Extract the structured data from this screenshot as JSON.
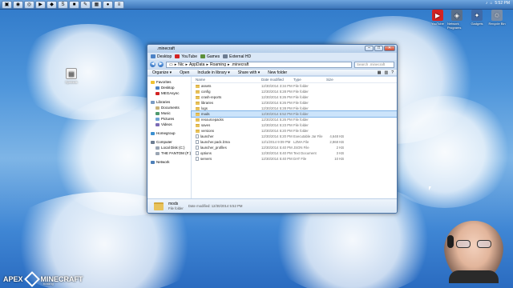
{
  "taskbar": {
    "buttons": [
      {
        "icon": "windows-explorer-icon",
        "glyph": "▣"
      },
      {
        "icon": "firefox-icon",
        "glyph": "◉"
      },
      {
        "icon": "chrome-icon",
        "glyph": "◎"
      },
      {
        "icon": "media-player-icon",
        "glyph": "▶"
      },
      {
        "icon": "steam-icon",
        "glyph": "◆"
      },
      {
        "icon": "skype-icon",
        "glyph": "S"
      },
      {
        "icon": "folder-icon",
        "glyph": "■"
      },
      {
        "icon": "paint-icon",
        "glyph": "✎"
      },
      {
        "icon": "minecraft-icon",
        "glyph": "▦"
      },
      {
        "icon": "obs-icon",
        "glyph": "●"
      },
      {
        "icon": "notepad-icon",
        "glyph": "≡"
      }
    ],
    "clock": "5:52 PM"
  },
  "desktop": {
    "left_icon_label": "Symbols",
    "right_icons": [
      {
        "label": "YouTube",
        "color": "#d32323",
        "glyph": "▶"
      },
      {
        "label": "Network Programs",
        "color": "#5a6f8a",
        "glyph": "◈"
      },
      {
        "label": "Gadgets",
        "color": "#3f6aa8",
        "glyph": "✦"
      },
      {
        "label": "Recycle Bin",
        "color": "#7a8da6",
        "glyph": "♲"
      }
    ]
  },
  "window": {
    "title": ".minecraft",
    "controls": {
      "minimize": "–",
      "maximize": "□",
      "close": "✕"
    },
    "favorites_bar": [
      {
        "label": "Desktop",
        "color": "#4b82c6"
      },
      {
        "label": "YouTube",
        "color": "#d32323"
      },
      {
        "label": "Games",
        "color": "#5c8f3a"
      },
      {
        "label": "External HD",
        "color": "#6d7d92"
      }
    ],
    "breadcrumb": [
      "Nic",
      "AppData",
      "Roaming",
      ".minecraft"
    ],
    "search_placeholder": "Search .minecraft",
    "commands": [
      "Organize ▾",
      "Open",
      "Include in library ▾",
      "Share with ▾",
      "New folder"
    ],
    "nav": {
      "favorites_header": "Favorites",
      "favorites": [
        "Desktop",
        "MEGAsync"
      ],
      "libraries_header": "Libraries",
      "libraries": [
        "Documents",
        "Music",
        "Pictures",
        "Videos"
      ],
      "homegroup": "Homegroup",
      "computer_header": "Computer",
      "drives": [
        "Local Disk (C:)",
        "THE FANTOM (F:)"
      ],
      "network": "Network"
    },
    "columns": {
      "name": "Name",
      "date": "Date modified",
      "type": "Type",
      "size": "Size"
    },
    "files": [
      {
        "name": "assets",
        "date": "12/30/2014 3:34 PM",
        "type": "File folder",
        "size": "",
        "kind": "folder"
      },
      {
        "name": "config",
        "date": "12/30/2014 5:28 PM",
        "type": "File folder",
        "size": "",
        "kind": "folder"
      },
      {
        "name": "crash-reports",
        "date": "12/30/2014 5:26 PM",
        "type": "File folder",
        "size": "",
        "kind": "folder"
      },
      {
        "name": "libraries",
        "date": "12/30/2014 5:26 PM",
        "type": "File folder",
        "size": "",
        "kind": "folder"
      },
      {
        "name": "logs",
        "date": "12/30/2014 5:28 PM",
        "type": "File folder",
        "size": "",
        "kind": "folder"
      },
      {
        "name": "mods",
        "date": "12/30/2014 5:52 PM",
        "type": "File folder",
        "size": "",
        "kind": "folder"
      },
      {
        "name": "resourcepacks",
        "date": "12/30/2014 5:26 PM",
        "type": "File folder",
        "size": "",
        "kind": "folder"
      },
      {
        "name": "saves",
        "date": "12/30/2014 5:23 PM",
        "type": "File folder",
        "size": "",
        "kind": "folder"
      },
      {
        "name": "versions",
        "date": "12/30/2014 5:20 PM",
        "type": "File folder",
        "size": "",
        "kind": "folder"
      },
      {
        "name": "launcher",
        "date": "12/30/2014 5:20 PM",
        "type": "Executable Jar File",
        "size": "4,648 KB",
        "kind": "file"
      },
      {
        "name": "launcher.pack.lzma",
        "date": "12/1/2014 9:09 PM",
        "type": "LZMA File",
        "size": "2,868 KB",
        "kind": "file"
      },
      {
        "name": "launcher_profiles",
        "date": "12/30/2014 5:40 PM",
        "type": "JSON File",
        "size": "2 KB",
        "kind": "file"
      },
      {
        "name": "options",
        "date": "12/30/2014 5:40 PM",
        "type": "Text Document",
        "size": "3 KB",
        "kind": "file"
      },
      {
        "name": "servers",
        "date": "12/30/2014 5:40 PM",
        "type": "DAT File",
        "size": "10 KB",
        "kind": "file"
      }
    ],
    "selected_index": 5,
    "details": {
      "name": "mods",
      "type": "File folder",
      "meta": "Date modified: 12/30/2014 5:52 PM"
    }
  },
  "branding": {
    "left": "APEX",
    "right": "MINECRAFT",
    "sub": "hosting"
  }
}
